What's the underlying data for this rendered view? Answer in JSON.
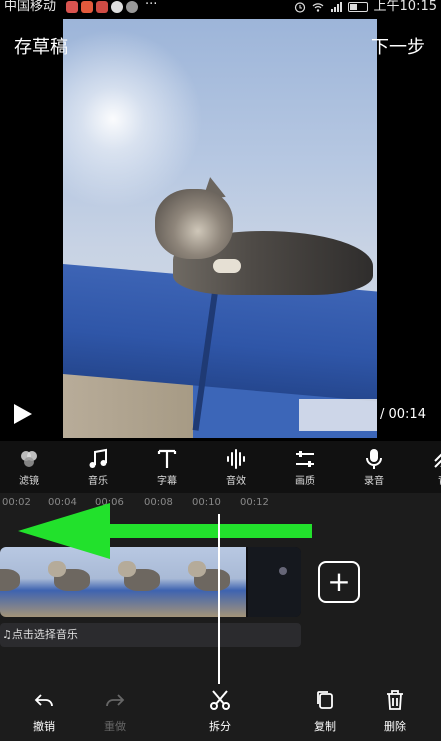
{
  "status_bar": {
    "carrier": "中国移动",
    "more": "···",
    "time": "上午10:15"
  },
  "top_bar": {
    "save_draft": "存草稿",
    "next_step": "下一步"
  },
  "player": {
    "duration": "/ 00:14"
  },
  "toolbar": {
    "items": [
      {
        "label": "滤镜",
        "icon": "filter-icon"
      },
      {
        "label": "音乐",
        "icon": "music-note-icon"
      },
      {
        "label": "字幕",
        "icon": "text-icon"
      },
      {
        "label": "音效",
        "icon": "sound-wave-icon"
      },
      {
        "label": "画质",
        "icon": "sliders-icon"
      },
      {
        "label": "录音",
        "icon": "microphone-icon"
      },
      {
        "label": "背",
        "icon": "background-icon"
      }
    ]
  },
  "timeline": {
    "ticks": [
      "00:02",
      "00:04",
      "00:06",
      "00:08",
      "00:10",
      "00:12"
    ],
    "music_hint": "点击选择音乐",
    "add_clip": "+"
  },
  "actions": {
    "undo": "撤销",
    "redo": "重做",
    "split": "拆分",
    "copy": "复制",
    "delete": "删除"
  },
  "colors": {
    "annotation_arrow": "#22e12c",
    "timeline_bg": "#1c1c1c",
    "toolbar_bg": "#111111"
  }
}
